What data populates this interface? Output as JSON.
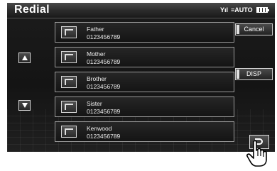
{
  "header": {
    "title": "Redial",
    "signal_label": "Yıl",
    "auto_label": "≡AUTO"
  },
  "entries": [
    {
      "name": "Father",
      "number": "0123456789"
    },
    {
      "name": "Mother",
      "number": "0123456789"
    },
    {
      "name": "Brother",
      "number": "0123456789"
    },
    {
      "name": "Sister",
      "number": "0123456789"
    },
    {
      "name": "Kenwood",
      "number": "0123456789"
    }
  ],
  "buttons": {
    "cancel_label": "Cancel",
    "disp_label": "DISP"
  },
  "icons": {
    "entry_icon": "phone-entry-icon",
    "scroll_up": "triangle-up-icon",
    "scroll_down": "triangle-down-icon",
    "back": "return-arrow-icon",
    "pointer": "hand-pointer-icon",
    "battery": "battery-icon"
  }
}
